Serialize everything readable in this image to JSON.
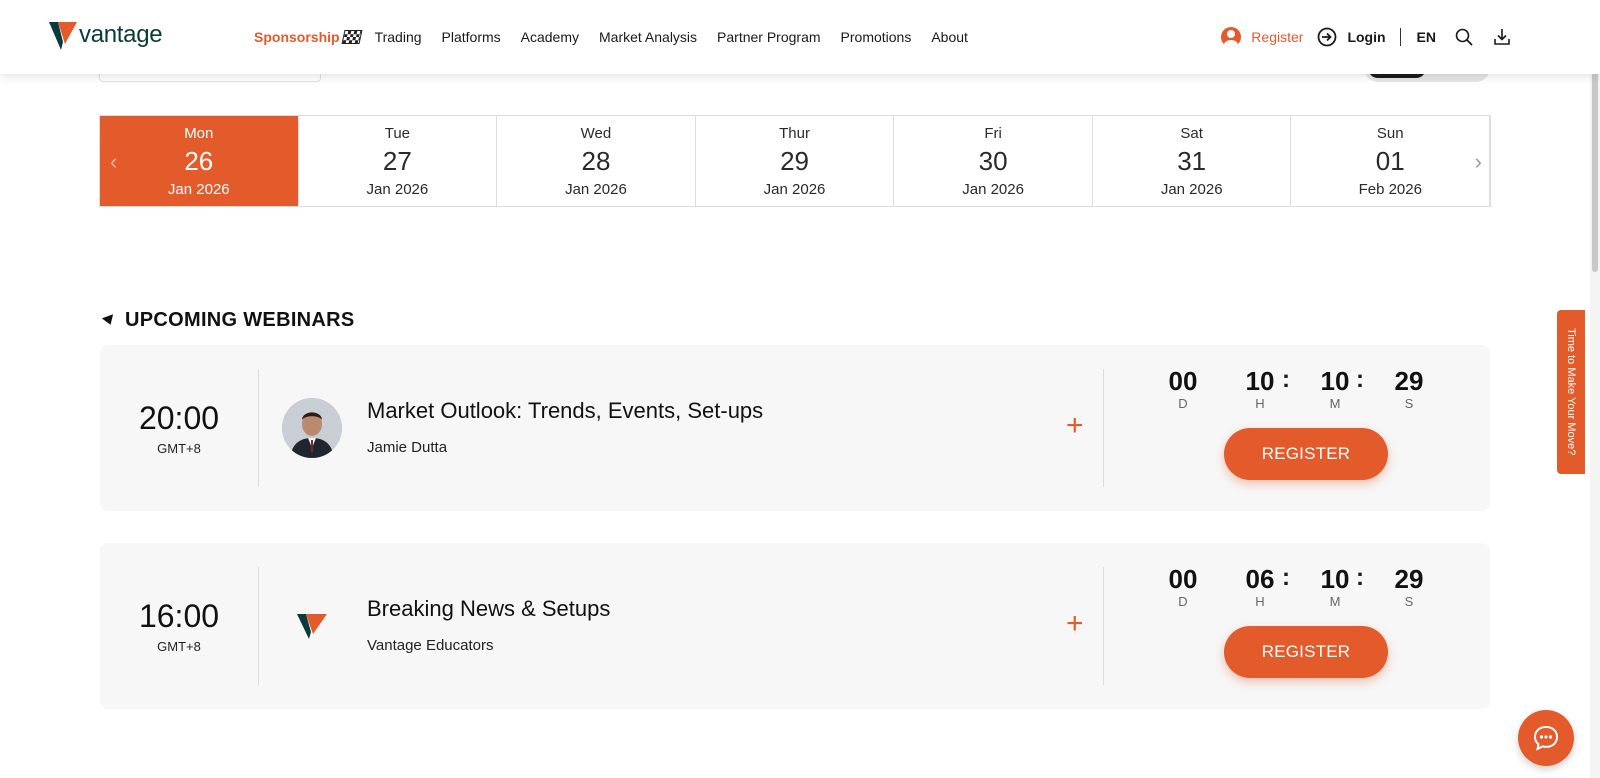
{
  "header": {
    "logo_text": "vantage",
    "nav": [
      {
        "label": "Sponsorship"
      },
      {
        "label": "Trading"
      },
      {
        "label": "Platforms"
      },
      {
        "label": "Academy"
      },
      {
        "label": "Market Analysis"
      },
      {
        "label": "Partner Program"
      },
      {
        "label": "Promotions"
      },
      {
        "label": "About"
      }
    ],
    "register_label": "Register",
    "login_label": "Login",
    "language": "EN"
  },
  "dates": [
    {
      "dow": "Mon",
      "day": "26",
      "month": "Jan 2026",
      "active": true
    },
    {
      "dow": "Tue",
      "day": "27",
      "month": "Jan 2026",
      "active": false
    },
    {
      "dow": "Wed",
      "day": "28",
      "month": "Jan 2026",
      "active": false
    },
    {
      "dow": "Thur",
      "day": "29",
      "month": "Jan 2026",
      "active": false
    },
    {
      "dow": "Fri",
      "day": "30",
      "month": "Jan 2026",
      "active": false
    },
    {
      "dow": "Sat",
      "day": "31",
      "month": "Jan 2026",
      "active": false
    },
    {
      "dow": "Sun",
      "day": "01",
      "month": "Feb 2026",
      "active": false
    }
  ],
  "section_title": "UPCOMING WEBINARS",
  "webinars": [
    {
      "time": "20:00",
      "timezone": "GMT+8",
      "title": "Market Outlook: Trends, Events, Set-ups",
      "presenter": "Jamie Dutta",
      "countdown": {
        "d": "00",
        "h": "10",
        "m": "10",
        "s": "29"
      },
      "register_label": "REGISTER"
    },
    {
      "time": "16:00",
      "timezone": "GMT+8",
      "title": "Breaking News & Setups",
      "presenter": "Vantage Educators",
      "countdown": {
        "d": "00",
        "h": "06",
        "m": "10",
        "s": "29"
      },
      "register_label": "REGISTER"
    }
  ],
  "countdown_labels": {
    "d": "D",
    "h": "H",
    "m": "M",
    "s": "S"
  },
  "side_tab_label": "Time to Make Your Move?",
  "colors": {
    "accent": "#e35a2b",
    "brand_dark": "#0b3a3a",
    "card_bg": "#f7f7f7"
  }
}
